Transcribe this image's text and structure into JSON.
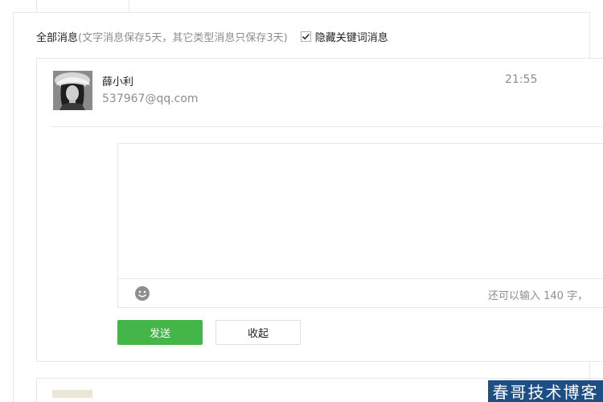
{
  "filter": {
    "title": "全部消息",
    "note": "(文字消息保存5天，其它类型消息只保存3天)",
    "hide_keyword_label": "隐藏关键词消息",
    "hide_keyword_checked": true
  },
  "message": {
    "sender_name": "薛小利",
    "sender_email": "537967@qq.com",
    "time": "21:55"
  },
  "reply": {
    "char_count_text": "还可以输入 140 字，",
    "send_label": "发送",
    "collapse_label": "收起"
  },
  "watermark": {
    "text": "春哥技术博客"
  },
  "colors": {
    "accent_green": "#44b549",
    "border": "#e7e7eb",
    "muted_text": "#8d8d8d",
    "watermark_bg": "#1d4f86"
  }
}
